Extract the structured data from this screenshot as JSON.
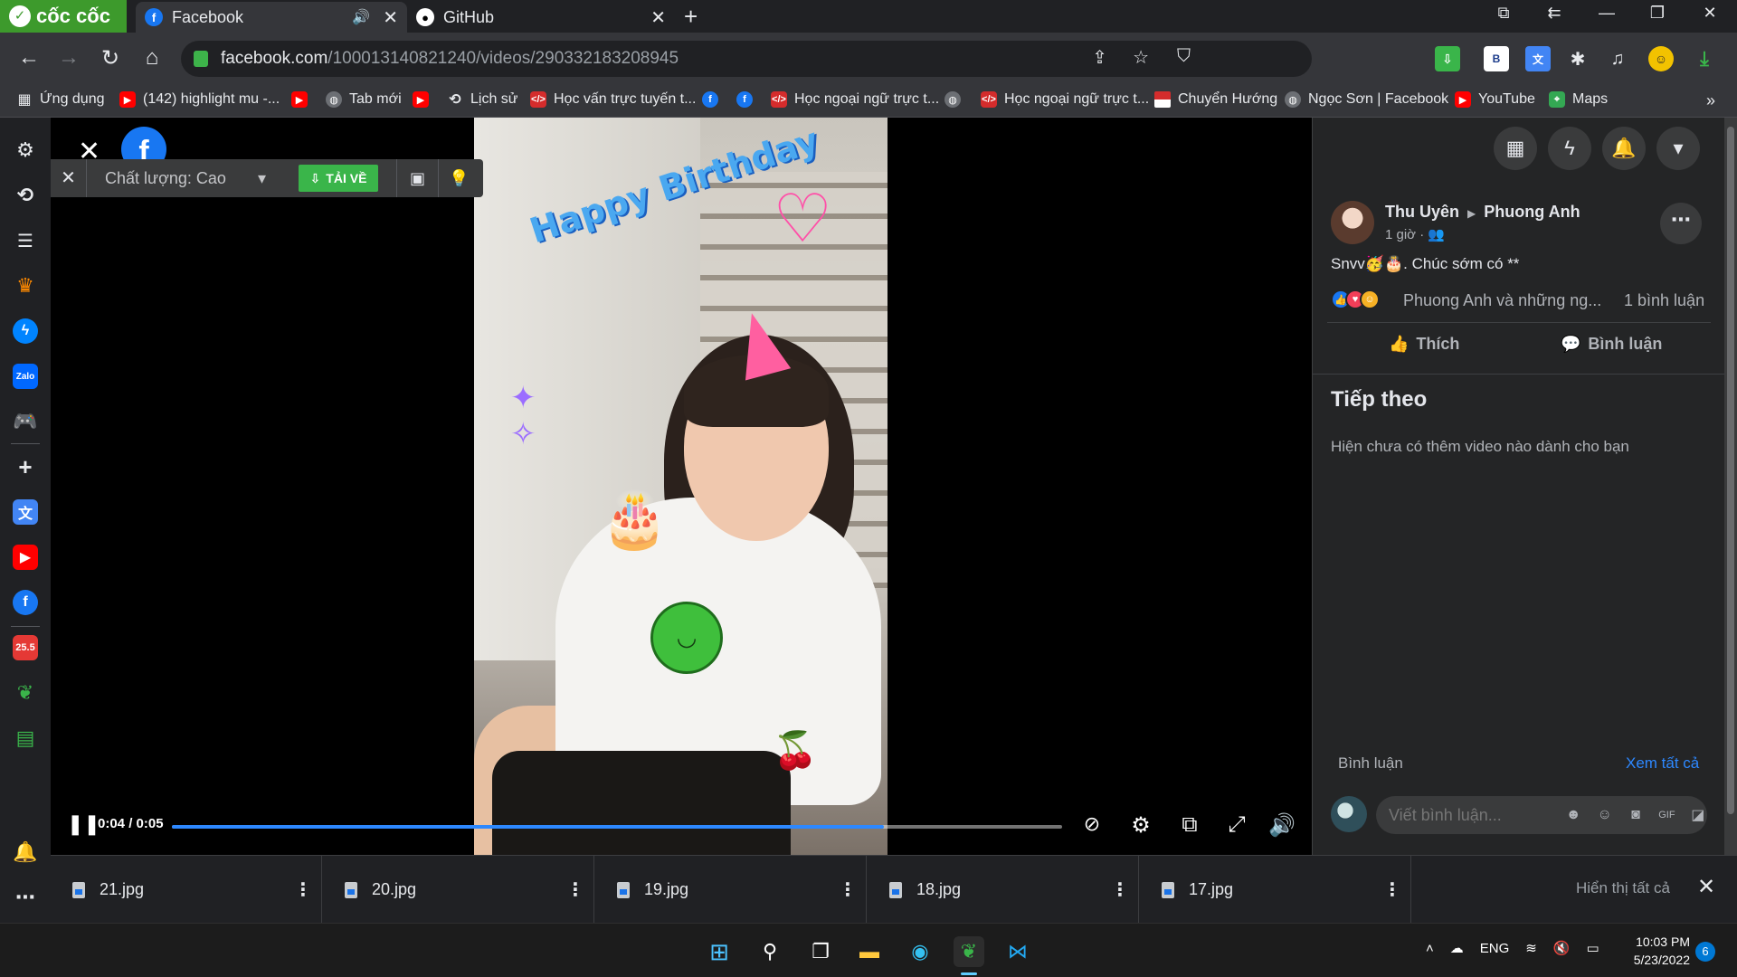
{
  "browser": {
    "brand": "cốc cốc",
    "tabs": [
      {
        "title": "Facebook",
        "icon": "facebook-icon",
        "active": true,
        "audio": true
      },
      {
        "title": "GitHub",
        "icon": "github-icon",
        "active": false,
        "audio": false
      }
    ],
    "url_host": "facebook.com",
    "url_path": "/100013140821240/videos/290332183208945"
  },
  "bookmarks": [
    {
      "label": "Ứng dụng",
      "icon": "apps-grid-icon"
    },
    {
      "label": "(142) highlight mu -...",
      "icon": "youtube-icon"
    },
    {
      "label": "",
      "icon": "youtube-icon"
    },
    {
      "label": "Tab mới",
      "icon": "globe-icon"
    },
    {
      "label": "",
      "icon": "youtube-icon"
    },
    {
      "label": "Lịch sử",
      "icon": "history-icon"
    },
    {
      "label": "Học vấn trực tuyến t...",
      "icon": "code-icon"
    },
    {
      "label": "",
      "icon": "facebook-icon"
    },
    {
      "label": "",
      "icon": "facebook-icon"
    },
    {
      "label": "Học ngoại ngữ trực t...",
      "icon": "code-icon"
    },
    {
      "label": "",
      "icon": "globe-icon"
    },
    {
      "label": "Học ngoại ngữ trực t...",
      "icon": "code-icon"
    },
    {
      "label": "Chuyển Hướng",
      "icon": "flag-icon"
    },
    {
      "label": "Ngọc Sơn | Facebook",
      "icon": "globe-icon"
    },
    {
      "label": "YouTube",
      "icon": "youtube-icon"
    },
    {
      "label": "Maps",
      "icon": "maps-icon"
    }
  ],
  "video_toolbar": {
    "quality_label": "Chất lượng: Cao",
    "download_label": "TẢI VỀ"
  },
  "player": {
    "time": "0:04 / 0:05",
    "progress_fraction": 0.8,
    "sticker_text": "Happy Birthday"
  },
  "post": {
    "author": "Thu Uyên",
    "recipient": "Phuong Anh",
    "time": "1 giờ ·",
    "text": "Snvv🥳🎂. Chúc sớm có **",
    "reaction_names": "Phuong Anh và những ng...",
    "comment_count": "1 bình luận",
    "like_label": "Thích",
    "comment_label": "Bình luận"
  },
  "next_section": {
    "title": "Tiếp theo",
    "empty": "Hiện chưa có thêm video nào dành cho bạn"
  },
  "comments": {
    "label": "Bình luận",
    "see_all": "Xem tất cả",
    "placeholder": "Viết bình luận..."
  },
  "downloads": {
    "files": [
      "21.jpg",
      "20.jpg",
      "19.jpg",
      "18.jpg",
      "17.jpg"
    ],
    "show_all": "Hiển thị tất cả"
  },
  "taskbar": {
    "language": "ENG",
    "time": "10:03 PM",
    "date": "5/23/2022",
    "notifications": "6"
  },
  "colors": {
    "facebook_blue": "#1877f2",
    "progress": "#2d88ff",
    "coccoc_green": "#3d9a2c",
    "download_green": "#3ab54a"
  }
}
